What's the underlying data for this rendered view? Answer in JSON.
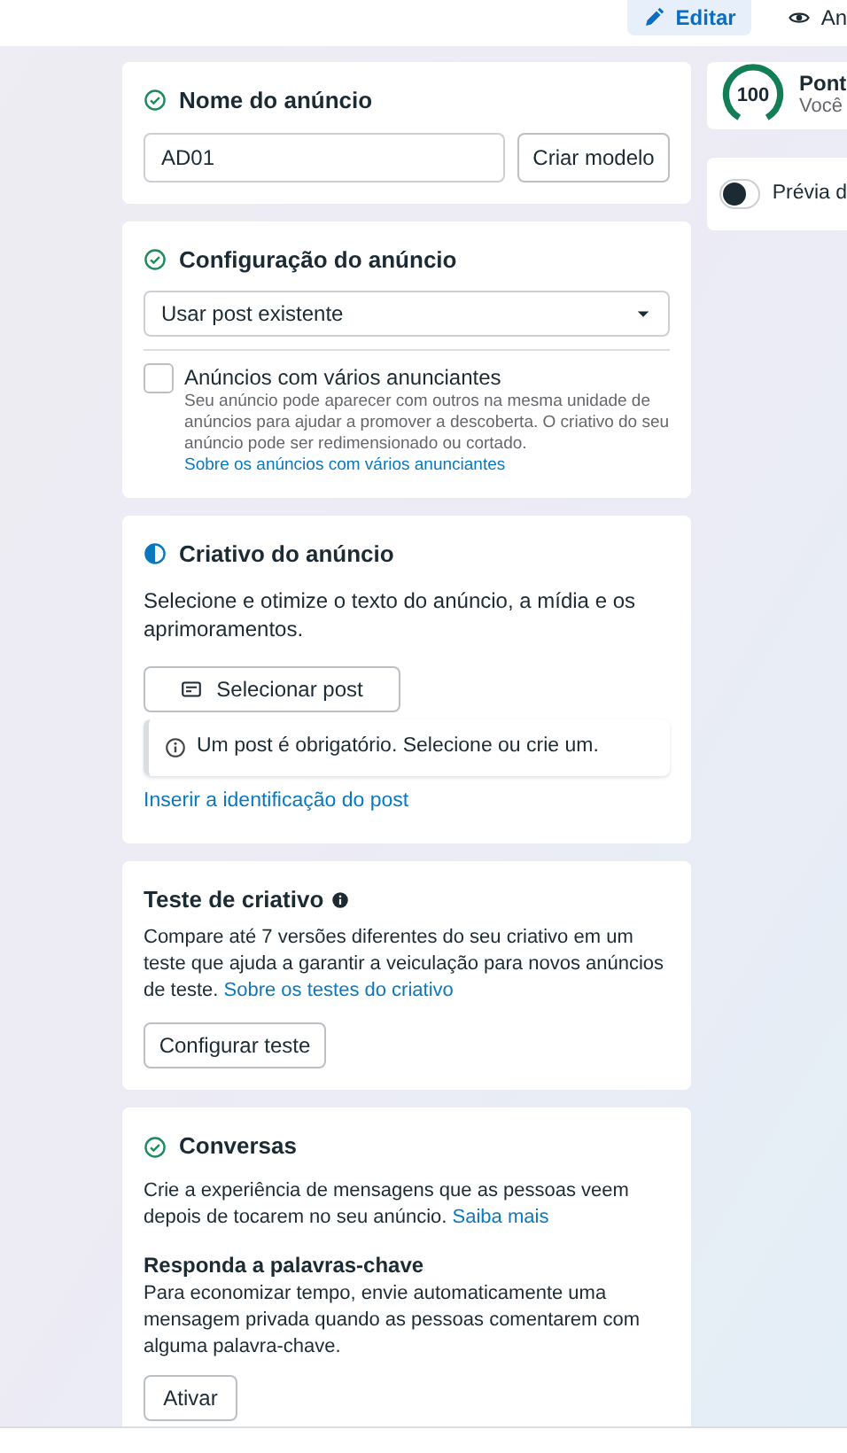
{
  "tabs": [
    {
      "label": "Editar",
      "selected": true
    },
    {
      "label": "An",
      "selected": false
    }
  ],
  "sections": [
    {
      "kind": "name",
      "complete": true,
      "partial": false,
      "title": "Nome do anúncio",
      "value": "AD01",
      "button": "Criar modelo"
    },
    {
      "kind": "config",
      "complete": true,
      "partial": false,
      "title": "Configuração do anúncio",
      "select": "Usar post existente",
      "checkbox": {
        "label": "Anúncios com vários anunciantes",
        "checked": false,
        "text": "Seu anúncio pode aparecer com outros na mesma unidade de anúncios para ajudar a promover a descoberta. O criativo do seu anúncio pode ser redimensionado ou cortado.",
        "link": "Sobre os anúncios com vários anunciantes"
      }
    },
    {
      "kind": "creative",
      "complete": false,
      "partial": true,
      "title": "Criativo do anúncio",
      "text": "Selecione e otimize o texto do anúncio, a mídia e os aprimoramentos.",
      "button": "Selecionar post",
      "notice": "Um post é obrigatório. Selecione ou crie um.",
      "link": "Inserir a identificação do post"
    },
    {
      "kind": "test",
      "complete": false,
      "partial": false,
      "title": "Teste de criativo",
      "text": "Compare até 7 versões diferentes do seu criativo em um teste que ajuda a garantir a veiculação para novos anúncios de teste.",
      "link": "Sobre os testes do criativo",
      "button": "Configurar teste"
    },
    {
      "kind": "conversations",
      "complete": true,
      "partial": false,
      "title": "Conversas",
      "text": "Crie a experiência de mensagens que as pessoas veem depois de tocarem no seu anúncio.",
      "link": "Saiba mais",
      "subtitle": "Responda a palavras-chave",
      "subtext": "Para economizar tempo, envie automaticamente uma mensagem privada quando as pessoas comentarem com alguma palavra-chave.",
      "button": "Ativar"
    }
  ],
  "score": {
    "value": "100",
    "title": "Pont",
    "text": "Você"
  },
  "preview": {
    "label": "Prévia d",
    "on": false
  }
}
